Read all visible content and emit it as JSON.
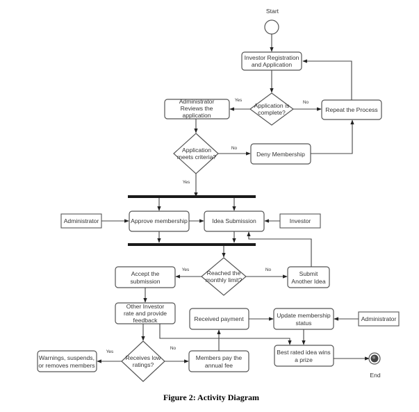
{
  "diagram": {
    "start_label": "Start",
    "end_label": "End",
    "caption": "Figure 2: Activity Diagram",
    "nodes": {
      "investor_registration": [
        "Investor Registration",
        "and Application"
      ],
      "application_complete": [
        "Application is",
        "complete?"
      ],
      "repeat_process": [
        "Repeat the Process"
      ],
      "admin_reviews": [
        "Administrator",
        "Reviews the",
        "application"
      ],
      "meets_criteria": [
        "Application",
        "meets criteria?"
      ],
      "deny_membership": [
        "Deny Membership"
      ],
      "administrator_actor_1": [
        "Administrator"
      ],
      "approve_membership": [
        "Approve membership"
      ],
      "idea_submission": [
        "Idea Submission"
      ],
      "investor_actor": [
        "Investor"
      ],
      "reached_limit": [
        "Reached the",
        "monthly limit?"
      ],
      "accept_submission": [
        "Accept the",
        "submission"
      ],
      "submit_another": [
        "Submit",
        "Another Idea"
      ],
      "other_investor_rate": [
        "Other Investor",
        "rate  and provide",
        "feedback"
      ],
      "received_payment": [
        "Received payment"
      ],
      "update_membership": [
        "Update membership",
        "status"
      ],
      "administrator_actor_2": [
        "Administrator"
      ],
      "receives_low_ratings": [
        "Receives low",
        "ratings?"
      ],
      "warnings": [
        "Warnings, suspends,",
        "or removes members"
      ],
      "members_pay": [
        "Members pay the",
        "annual fee"
      ],
      "best_rated": [
        "Best rated idea wins",
        "a prize"
      ]
    },
    "edge_labels": {
      "complete_yes": "Yes",
      "complete_no": "No",
      "criteria_no": "No",
      "criteria_yes": "Yes",
      "limit_yes": "Yes",
      "limit_no": "No",
      "ratings_yes": "Yes",
      "ratings_no": "No"
    }
  }
}
